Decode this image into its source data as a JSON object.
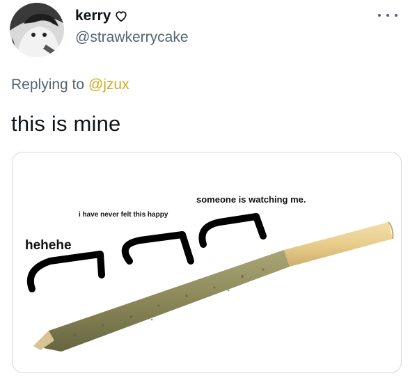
{
  "user": {
    "display_name": "kerry",
    "handle": "@strawkerrycake"
  },
  "reply": {
    "prefix": "Replying to",
    "mention": "@jzux"
  },
  "tweet": {
    "text": "this is mine"
  },
  "media": {
    "labels": {
      "watching": "someone is watching me.",
      "happy": "i have never felt this happy",
      "hehehe": "hehehe"
    }
  },
  "colors": {
    "mention": "#d4a71e",
    "secondary_text": "#536471",
    "primary_text": "#0f1419"
  },
  "icons": {
    "heart": "heart-outline-icon",
    "more": "more-dots-icon"
  }
}
